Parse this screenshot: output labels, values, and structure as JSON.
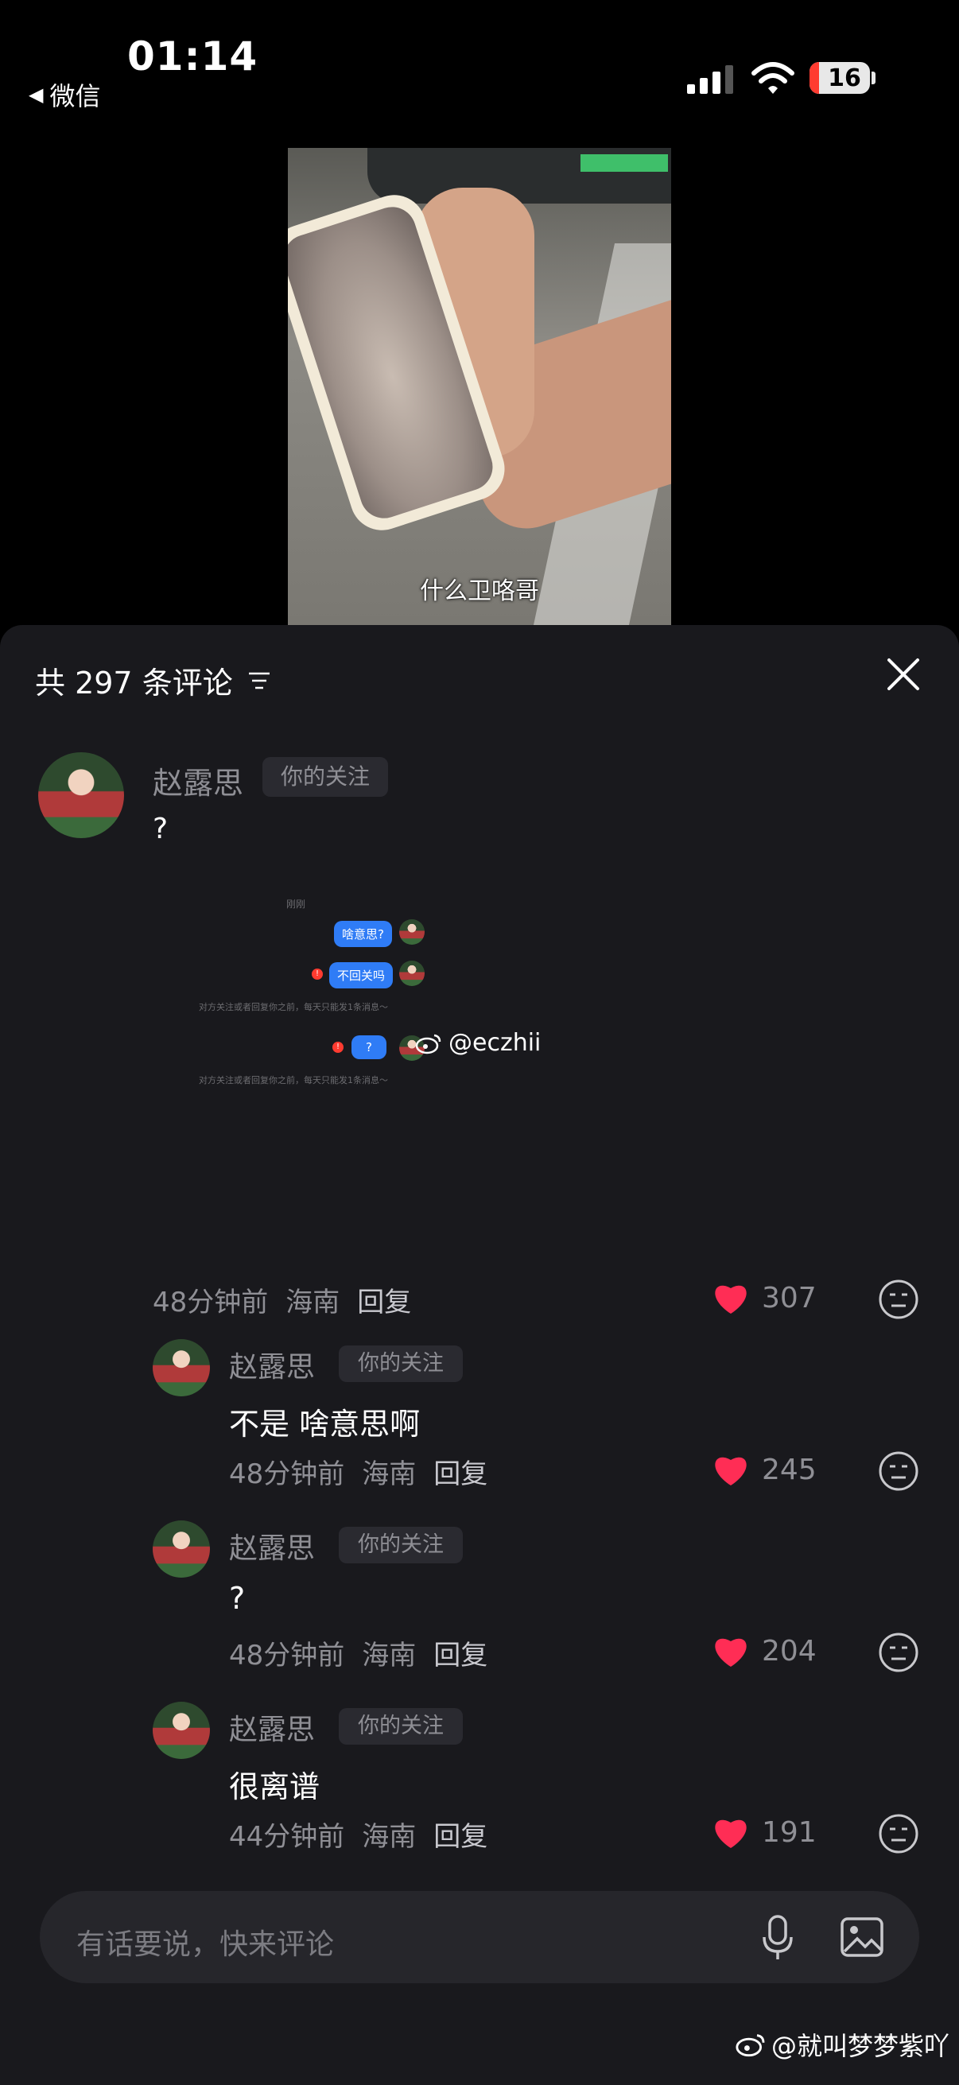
{
  "status_bar": {
    "time": "01:14",
    "back_label": "微信",
    "battery": "16"
  },
  "video": {
    "caption": "什么卫咯哥"
  },
  "comments_panel": {
    "title": "共 297 条评论"
  },
  "comments": [
    {
      "user": "赵露思",
      "tag": "你的关注",
      "text": "?",
      "time": "48分钟前",
      "location": "海南",
      "reply": "回复",
      "likes": "307",
      "embedded_chat": {
        "timestamp": "刚刚",
        "messages": [
          "啥意思?",
          "不回关吗",
          "?"
        ],
        "notices": [
          "对方关注或者回复你之前，每天只能发1条消息～",
          "对方关注或者回复你之前，每天只能发1条消息～"
        ],
        "watermark": "@eczhii"
      }
    },
    {
      "user": "赵露思",
      "tag": "你的关注",
      "text": "不是 啥意思啊",
      "time": "48分钟前",
      "location": "海南",
      "reply": "回复",
      "likes": "245"
    },
    {
      "user": "赵露思",
      "tag": "你的关注",
      "text": "?",
      "time": "48分钟前",
      "location": "海南",
      "reply": "回复",
      "likes": "204"
    },
    {
      "user": "赵露思",
      "tag": "你的关注",
      "text": "很离谱",
      "time": "44分钟前",
      "location": "海南",
      "reply": "回复",
      "likes": "191"
    }
  ],
  "input": {
    "placeholder": "有话要说，快来评论"
  },
  "watermark": "@就叫梦梦紫吖",
  "colors": {
    "like_red": "#ff2d55",
    "bubble_blue": "#2f7cf6",
    "sheet_bg": "#19191d"
  },
  "icons": [
    "wifi-icon",
    "signal-icon",
    "filter-icon",
    "close-icon",
    "heart-icon",
    "dislike-icon",
    "mic-icon",
    "image-icon",
    "weibo-icon"
  ]
}
